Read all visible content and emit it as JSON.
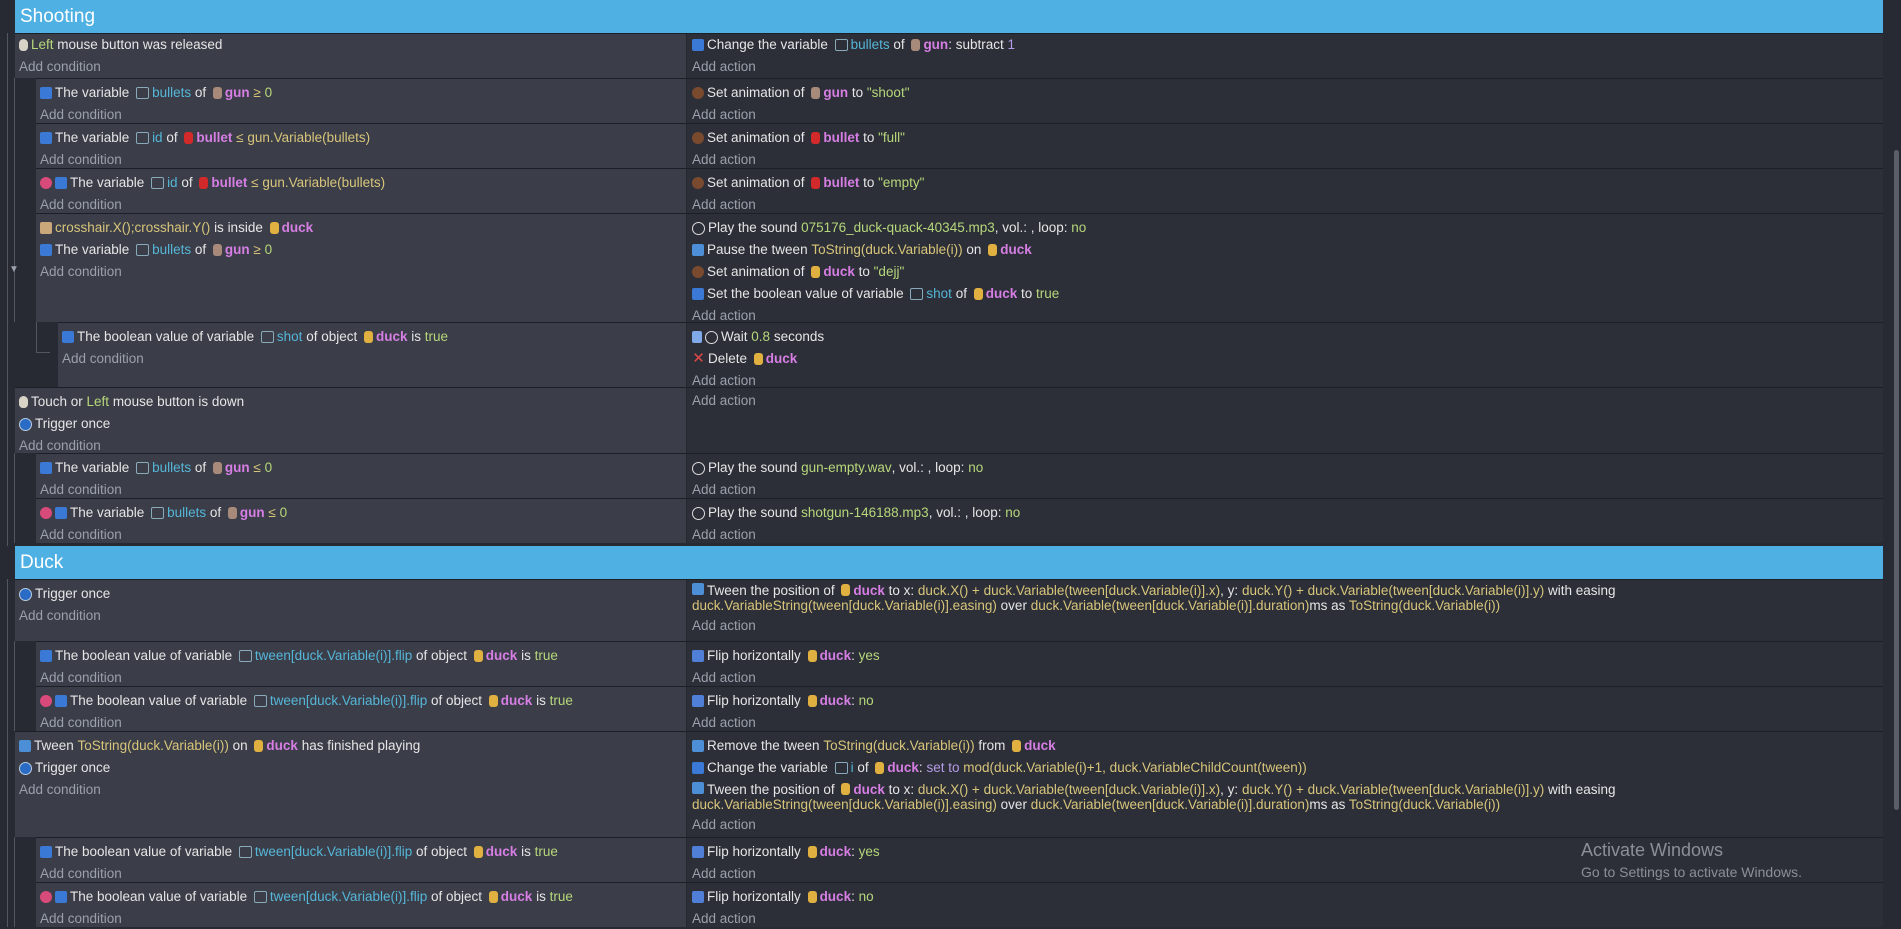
{
  "add_condition": "Add condition",
  "add_action": "Add action",
  "groups": {
    "shooting": "Shooting",
    "duck": "Duck"
  },
  "t": {
    "left": "Left",
    "mouse_released": " mouse button was released",
    "touch_or": "Touch or ",
    "mouse_down": " mouse button is down",
    "trigger_once": "Trigger once",
    "the_variable": "The variable",
    "of": "of",
    "bullets": "bullets",
    "id": "id",
    "gun": "gun",
    "bullet": "bullet",
    "duck": "duck",
    "ge": "≥",
    "le": "≤",
    "zero": "0",
    "gun_var_bullets": "gun.Variable(bullets)",
    "crosshair_xy": "crosshair.X();crosshair.Y()",
    "is_inside": "is inside",
    "bool_value_of": "The boolean value of variable",
    "shot": "shot",
    "of_object": "of object",
    "is": "is",
    "true": "true",
    "change_variable": "Change the variable",
    "colon_subtract": ": subtract",
    "one": "1",
    "set_animation_of": "Set animation of",
    "to": "to",
    "shoot_q": "\"shoot\"",
    "full_q": "\"full\"",
    "empty_q": "\"empty\"",
    "dejj_q": "\"dejj\"",
    "play_sound": "Play the sound",
    "snd_quack": "075176_duck-quack-40345.mp3",
    "snd_empty": "gun-empty.wav",
    "snd_shotgun": "shotgun-146188.mp3",
    "vol_loop": ", vol.: , loop:",
    "no": "no",
    "yes": "yes",
    "pause_tween": "Pause the tween",
    "tostring_duck": "ToString(duck.Variable(i))",
    "on": "on",
    "set_bool_value": "Set the boolean value of variable",
    "wait": "Wait",
    "wait_secs": "0.8",
    "seconds": "seconds",
    "delete": "Delete",
    "tween_position": "Tween the position of",
    "to_x": "to x:",
    "tween_x_expr": "duck.X() + duck.Variable(tween[duck.Variable(i)].x)",
    "y_label": ", y:",
    "tween_y_expr": "duck.Y() + duck.Variable(tween[duck.Variable(i)].y)",
    "with_easing": "with easing",
    "easing_expr": "duck.VariableString(tween[duck.Variable(i)].easing)",
    "over": "over",
    "duration_expr": "duck.Variable(tween[duck.Variable(i)].duration)",
    "ms_as": "ms as",
    "flip_var": "tween[duck.Variable(i)].flip",
    "flip_horizontally": "Flip horizontally",
    "colon": ":",
    "tween_label": "Tween",
    "has_finished": "has finished playing",
    "remove_tween": "Remove the tween",
    "from": "from",
    "i": "i",
    "set_to": "set to",
    "mod_expr": "mod(duck.Variable(i)+1, duck.VariableChildCount(tween))"
  },
  "watermark": {
    "title": "Activate Windows",
    "subtitle": "Go to Settings to activate Windows."
  },
  "colors": {
    "group_header": "#4fb0e3",
    "condition_bg": "#3b3e49",
    "action_bg": "#2c2f38",
    "object": "#d67ee4",
    "variable": "#55b6d8",
    "string": "#b6d77a"
  }
}
